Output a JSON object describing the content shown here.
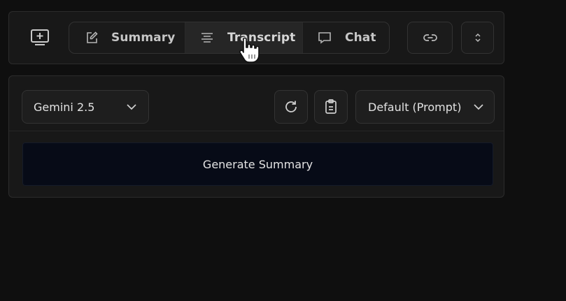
{
  "header": {
    "capture_icon": "screen-plus-icon",
    "tabs": [
      {
        "label": "Summary",
        "icon": "edit-note-icon"
      },
      {
        "label": "Transcript",
        "icon": "text-align-center-icon"
      },
      {
        "label": "Chat",
        "icon": "chat-bubble-icon"
      }
    ],
    "link_icon": "link-icon",
    "expand_icon": "chevron-up-down-icon"
  },
  "summary_panel": {
    "model_select": {
      "value": "Gemini 2.5",
      "icon": "chevron-down-icon"
    },
    "refresh_icon": "refresh-icon",
    "copy_icon": "clipboard-copy-icon",
    "prompt_select": {
      "value": "Default (Prompt)",
      "icon": "chevron-down-icon"
    },
    "generate_label": "Generate Summary"
  },
  "colors": {
    "background": "#0f0f0f",
    "panel": "#181818",
    "active_tab": "#262626",
    "generate_button": "#070b17"
  }
}
